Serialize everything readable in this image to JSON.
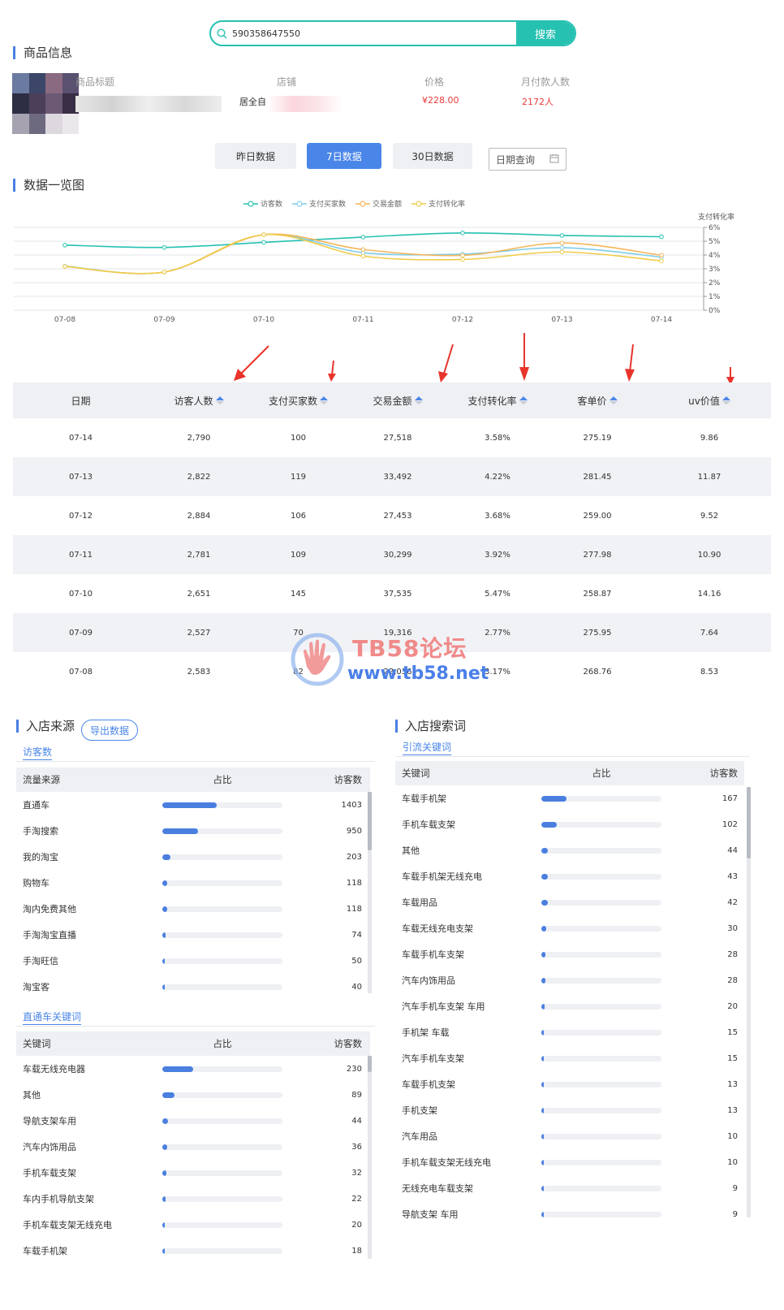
{
  "search": {
    "value": "590358647550",
    "button": "搜索"
  },
  "product": {
    "section_title": "商品信息",
    "col_title": "商品标题",
    "col_store": "店铺",
    "col_price": "价格",
    "col_monthly": "月付款人数",
    "store_partial": "居全自",
    "price": "¥228.00",
    "monthly_buyers": "2172人"
  },
  "ranges": {
    "yesterday": "昨日数据",
    "week": "7日数据",
    "month": "30日数据",
    "date_query": "日期查询"
  },
  "overview": {
    "section_title": "数据一览图"
  },
  "colors": {
    "accent": "#4a86e8",
    "teal": "#26c1b1",
    "orange": "#f5b55a",
    "yellow": "#f0cc4a",
    "cyan": "#7fcde6",
    "red_arrow": "#e8342b"
  },
  "chart_data": {
    "type": "line",
    "x": [
      "07-08",
      "07-09",
      "07-10",
      "07-11",
      "07-12",
      "07-13",
      "07-14"
    ],
    "series": [
      {
        "name": "访客数",
        "values": [
          2583,
          2527,
          2651,
          2781,
          2884,
          2822,
          2790
        ],
        "color": "#26c1b1"
      },
      {
        "name": "支付买家数",
        "values": [
          82,
          70,
          145,
          109,
          106,
          119,
          100
        ],
        "color": "#7fcde6"
      },
      {
        "name": "交易金额",
        "values": [
          22036,
          19316,
          37535,
          30299,
          27453,
          33492,
          27518
        ],
        "color": "#f5b55a"
      },
      {
        "name": "支付转化率",
        "values": [
          3.17,
          2.77,
          5.47,
          3.92,
          3.68,
          4.22,
          3.58
        ],
        "color": "#f0cc4a"
      }
    ],
    "y2label": "支付转化率",
    "y2ticks": [
      "6%",
      "5%",
      "4%",
      "3%",
      "2%",
      "1%",
      "0%"
    ],
    "grid": true,
    "legend": "top-center"
  },
  "table": {
    "headers": [
      "日期",
      "访客人数",
      "支付买家数",
      "交易金额",
      "支付转化率",
      "客单价",
      "uv价值"
    ],
    "rows": [
      [
        "07-14",
        "2,790",
        "100",
        "27,518",
        "3.58%",
        "275.19",
        "9.86"
      ],
      [
        "07-13",
        "2,822",
        "119",
        "33,492",
        "4.22%",
        "281.45",
        "11.87"
      ],
      [
        "07-12",
        "2,884",
        "106",
        "27,453",
        "3.68%",
        "259.00",
        "9.52"
      ],
      [
        "07-11",
        "2,781",
        "109",
        "30,299",
        "3.92%",
        "277.98",
        "10.90"
      ],
      [
        "07-10",
        "2,651",
        "145",
        "37,535",
        "5.47%",
        "258.87",
        "14.16"
      ],
      [
        "07-09",
        "2,527",
        "70",
        "19,316",
        "2.77%",
        "275.95",
        "7.64"
      ],
      [
        "07-08",
        "2,583",
        "82",
        "22,036",
        "3.17%",
        "268.76",
        "8.53"
      ]
    ]
  },
  "watermark": {
    "line1": "TB58论坛",
    "line2": "www.tb58.net"
  },
  "traffic": {
    "title": "入店来源",
    "export": "导出数据",
    "tab_visitors": "访客数",
    "headers": [
      "流量来源",
      "占比",
      "访客数"
    ],
    "rows": [
      {
        "name": "直通车",
        "value": 1403,
        "share": 0.45
      },
      {
        "name": "手淘搜索",
        "value": 950,
        "share": 0.3
      },
      {
        "name": "我的淘宝",
        "value": 203,
        "share": 0.065
      },
      {
        "name": "购物车",
        "value": 118,
        "share": 0.038
      },
      {
        "name": "淘内免费其他",
        "value": 118,
        "share": 0.038
      },
      {
        "name": "手淘淘宝直播",
        "value": 74,
        "share": 0.024
      },
      {
        "name": "手淘旺信",
        "value": 50,
        "share": 0.016
      },
      {
        "name": "淘宝客",
        "value": 40,
        "share": 0.013
      }
    ],
    "kw_tab": "直通车关键词",
    "kw_headers": [
      "关键词",
      "占比",
      "访客数"
    ],
    "kw_rows": [
      {
        "name": "车载无线充电器",
        "value": 230,
        "share": 0.26
      },
      {
        "name": "其他",
        "value": 89,
        "share": 0.1
      },
      {
        "name": "导航支架车用",
        "value": 44,
        "share": 0.05
      },
      {
        "name": "汽车内饰用品",
        "value": 36,
        "share": 0.04
      },
      {
        "name": "手机车载支架",
        "value": 32,
        "share": 0.036
      },
      {
        "name": "车内手机导航支架",
        "value": 22,
        "share": 0.025
      },
      {
        "name": "手机车载支架无线充电",
        "value": 20,
        "share": 0.023
      },
      {
        "name": "车载手机架",
        "value": 18,
        "share": 0.02
      }
    ]
  },
  "search_terms": {
    "title": "入店搜索词",
    "tab": "引流关键词",
    "headers": [
      "关键词",
      "占比",
      "访客数"
    ],
    "rows": [
      {
        "name": "车载手机架",
        "value": 167,
        "share": 0.21
      },
      {
        "name": "手机车载支架",
        "value": 102,
        "share": 0.13
      },
      {
        "name": "其他",
        "value": 44,
        "share": 0.055
      },
      {
        "name": "车载手机架无线充电",
        "value": 43,
        "share": 0.054
      },
      {
        "name": "车载用品",
        "value": 42,
        "share": 0.053
      },
      {
        "name": "车载无线充电支架",
        "value": 30,
        "share": 0.038
      },
      {
        "name": "车载手机车支架",
        "value": 28,
        "share": 0.035
      },
      {
        "name": "汽车内饰用品",
        "value": 28,
        "share": 0.035
      },
      {
        "name": "汽车手机车支架 车用",
        "value": 20,
        "share": 0.025
      },
      {
        "name": "手机架 车载",
        "value": 15,
        "share": 0.019
      },
      {
        "name": "汽车手机车支架",
        "value": 15,
        "share": 0.019
      },
      {
        "name": "车载手机支架",
        "value": 13,
        "share": 0.016
      },
      {
        "name": "手机支架",
        "value": 13,
        "share": 0.016
      },
      {
        "name": "汽车用品",
        "value": 10,
        "share": 0.013
      },
      {
        "name": "手机车载支架无线充电",
        "value": 10,
        "share": 0.013
      },
      {
        "name": "无线充电车载支架",
        "value": 9,
        "share": 0.011
      },
      {
        "name": "导航支架 车用",
        "value": 9,
        "share": 0.011
      }
    ]
  }
}
